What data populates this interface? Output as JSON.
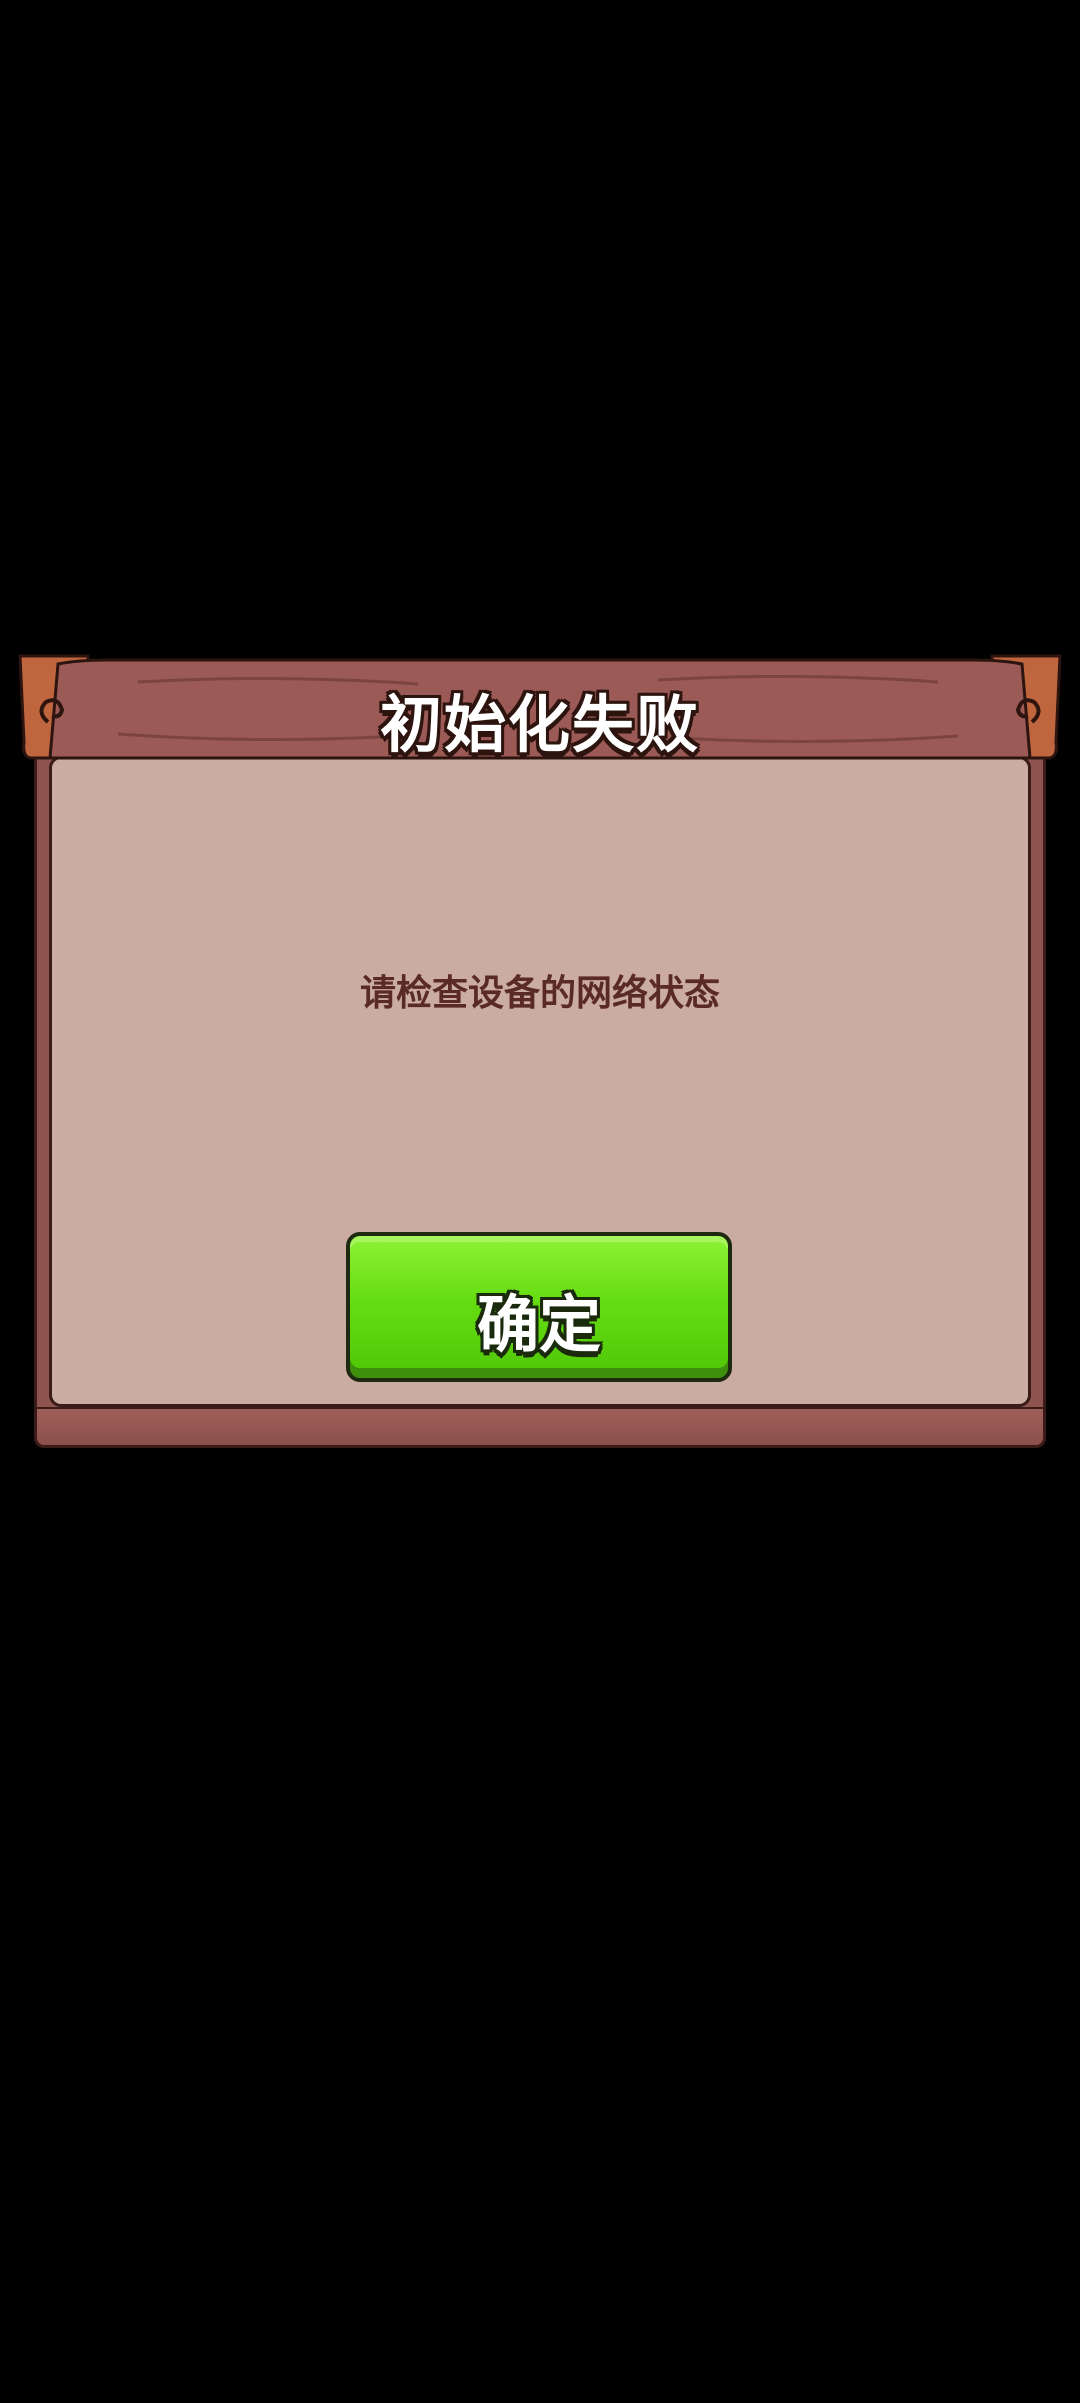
{
  "dialog": {
    "title": "初始化失败",
    "message": "请检查设备的网络状态",
    "confirm_label": "确定"
  },
  "colors": {
    "background": "#000000",
    "wood_frame": "#8f5450",
    "panel": "#cbaca2",
    "message_text": "#5a2a24",
    "button_green": "#66dd12"
  }
}
